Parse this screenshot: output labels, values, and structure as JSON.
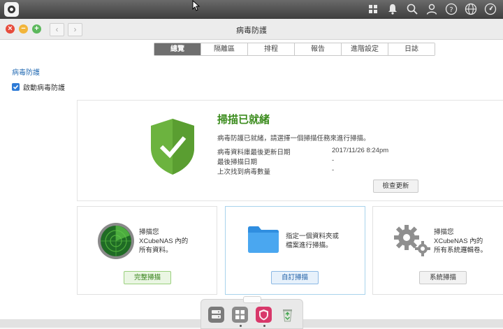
{
  "window": {
    "title": "病毒防護"
  },
  "tabs": [
    "總覽",
    "隔離區",
    "排程",
    "報告",
    "進階設定",
    "日誌"
  ],
  "active_tab": "總覽",
  "section": {
    "title": "病毒防護",
    "enable_label": "啟動病毒防護",
    "enabled": true
  },
  "status": {
    "title": "掃描已就緒",
    "description": "病毒防護已就緒，請選擇一個掃描任務來進行掃描。",
    "rows": [
      {
        "label": "病毒資料庫最後更新日期",
        "value": "2017/11/26 8:24pm"
      },
      {
        "label": "最後掃描日期",
        "value": "-"
      },
      {
        "label": "上次找到病毒數量",
        "value": "-"
      }
    ],
    "check_update_button": "檢查更新"
  },
  "cards": [
    {
      "lines": [
        "掃描您",
        "XCubeNAS 內的",
        "所有資料。"
      ],
      "button": "完整掃描",
      "icon": "radar-icon"
    },
    {
      "lines": [
        "指定一個資料夾或",
        "檔案進行掃描。"
      ],
      "button": "自訂掃描",
      "icon": "folder-icon"
    },
    {
      "lines": [
        "掃描您",
        "XCubeNAS 內的",
        "所有系統邏輯卷。"
      ],
      "button": "系統掃描",
      "icon": "gears-icon"
    }
  ],
  "colors": {
    "accent_blue": "#2a6fb5",
    "ready_green": "#3c8c1e",
    "shield_green": "#6cb33f",
    "active_tab": "#6f6f6f"
  },
  "topbar_icons": [
    "apps-icon",
    "bell-icon",
    "search-icon",
    "user-icon",
    "help-icon",
    "globe-icon",
    "gauge-icon"
  ],
  "dock_icons": [
    "storage-manager-icon",
    "apps-grid-icon",
    "antivirus-icon",
    "recycle-bin-icon"
  ]
}
